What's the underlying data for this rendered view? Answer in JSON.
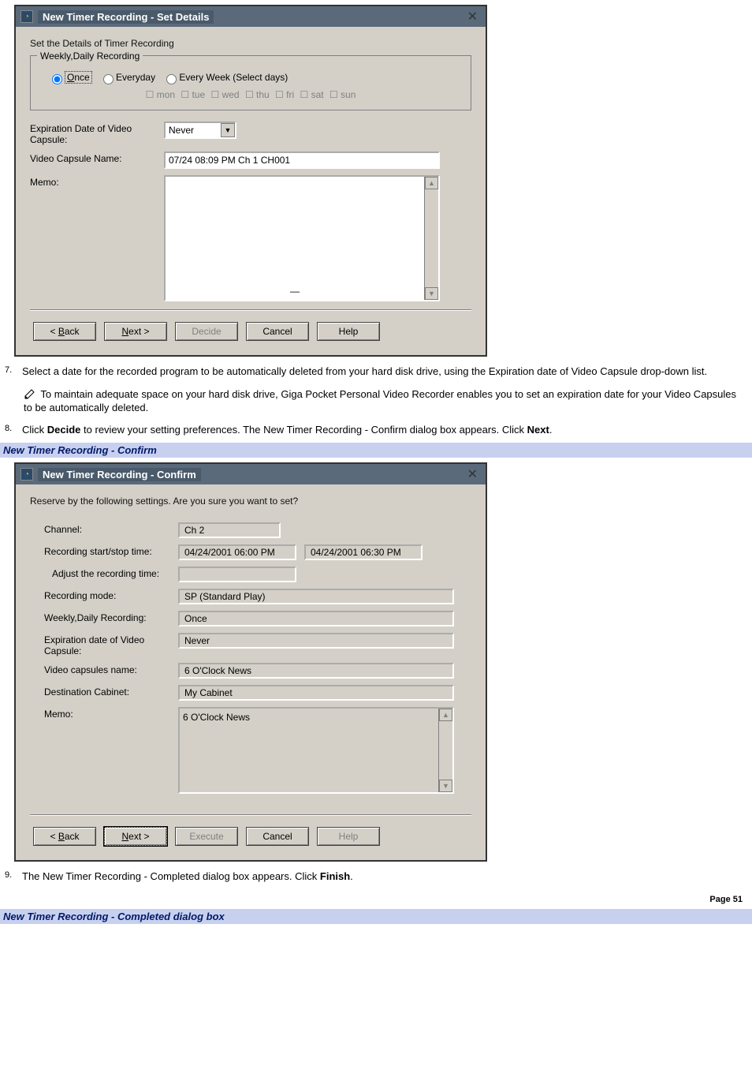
{
  "dialog1": {
    "title": "New Timer Recording - Set Details",
    "instruction": "Set the Details of Timer Recording",
    "group_title": "Weekly,Daily Recording",
    "radio": {
      "once": "Once",
      "everyday": "Everyday",
      "selectdays": "Every Week (Select days)"
    },
    "days": {
      "mon": "mon",
      "tue": "tue",
      "wed": "wed",
      "thu": "thu",
      "fri": "fri",
      "sat": "sat",
      "sun": "sun"
    },
    "expiration_label": "Expiration Date of Video Capsule:",
    "expiration_value": "Never",
    "capsule_name_label": "Video Capsule Name:",
    "capsule_name_value": "07/24 08:09 PM Ch 1 CH001",
    "memo_label": "Memo:",
    "memo_value": "—",
    "buttons": {
      "back": "< Back",
      "next": "Next >",
      "decide": "Decide",
      "cancel": "Cancel",
      "help": "Help"
    }
  },
  "step7": {
    "num": "7.",
    "text": "Select a date for the recorded program to be automatically deleted from your hard disk drive, using the Expiration date of Video Capsule drop-down list."
  },
  "note1": "To maintain adequate space on your hard disk drive, Giga Pocket Personal Video Recorder enables you to set an expiration date for your Video Capsules to be automatically deleted.",
  "step8": {
    "num": "8.",
    "prefix": "Click ",
    "bold1": "Decide",
    "mid": " to review your setting preferences. The New Timer Recording - Confirm dialog box appears. Click ",
    "bold2": "Next",
    "suffix": "."
  },
  "heading2": "New Timer Recording - Confirm",
  "dialog2": {
    "title": "New Timer Recording - Confirm",
    "instruction": "Reserve by the following settings. Are you sure you want to set?",
    "labels": {
      "channel": "Channel:",
      "startstop": "Recording start/stop time:",
      "adjust": "Adjust the recording time:",
      "mode": "Recording mode:",
      "weekly": "Weekly,Daily Recording:",
      "expiration": "Expiration date of Video Capsule:",
      "capsules": "Video capsules name:",
      "cabinet": "Destination Cabinet:",
      "memo": "Memo:"
    },
    "values": {
      "channel": "Ch 2",
      "start": "04/24/2001 06:00 PM",
      "stop": "04/24/2001 06:30 PM",
      "adjust": "",
      "mode": "SP (Standard Play)",
      "weekly": "Once",
      "expiration": "Never",
      "capsules": "6 O'Clock News",
      "cabinet": "My Cabinet",
      "memo": "6 O'Clock News"
    },
    "buttons": {
      "back": "< Back",
      "next": "Next >",
      "execute": "Execute",
      "cancel": "Cancel",
      "help": "Help"
    }
  },
  "step9": {
    "num": "9.",
    "prefix": "The New Timer Recording - Completed dialog box appears. Click ",
    "bold1": "Finish",
    "suffix": "."
  },
  "page_footer": "Page 51",
  "heading3": "New Timer Recording - Completed dialog box"
}
